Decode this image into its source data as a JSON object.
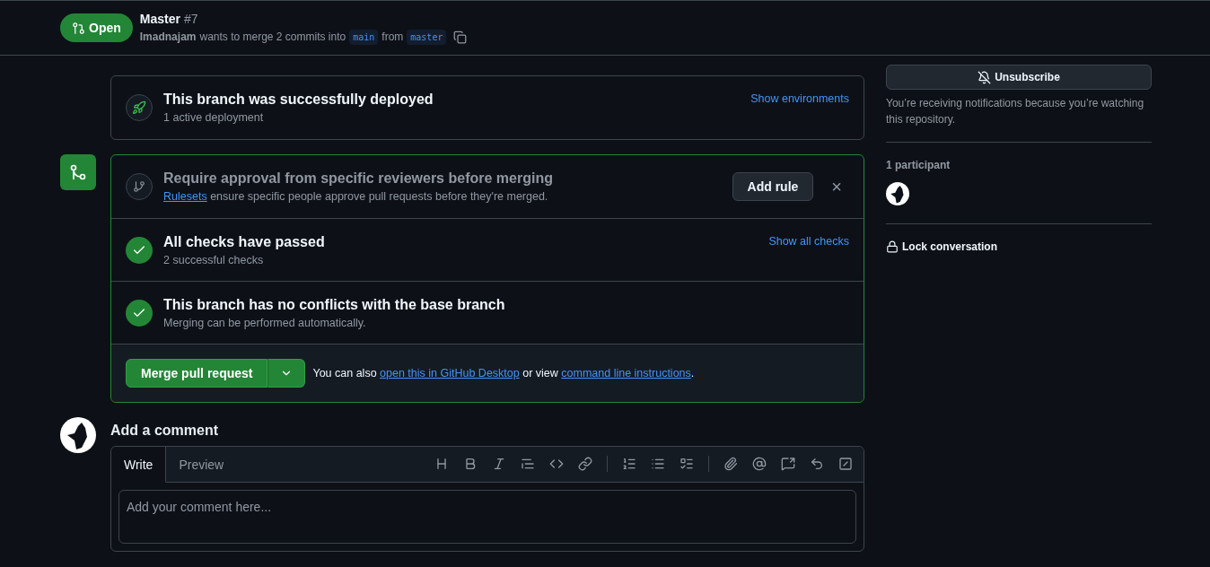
{
  "header": {
    "state": "Open",
    "title": "Master",
    "number": "#7",
    "author": "Imadnajam",
    "summary": "wants to merge 2 commits into",
    "base_branch": "main",
    "joiner": "from",
    "head_branch": "master"
  },
  "deployment": {
    "title": "This branch was successfully deployed",
    "subtitle": "1 active deployment",
    "action": "Show environments"
  },
  "merge_box": {
    "sections": [
      {
        "kind": "rule",
        "title": "Require approval from specific reviewers before merging",
        "link": "Rulesets",
        "text": "ensure specific people approve pull requests before they're merged.",
        "button": "Add rule",
        "close": "×"
      },
      {
        "kind": "check",
        "title": "All checks have passed",
        "subtitle": "2 successful checks",
        "action": "Show all checks"
      },
      {
        "kind": "check",
        "title": "This branch has no conflicts with the base branch",
        "subtitle": "Merging can be performed automatically."
      }
    ],
    "merge_button": "Merge pull request",
    "also_text": "You can also",
    "desktop_link": "open this in GitHub Desktop",
    "or_view": "or view",
    "cli_link": "command line instructions",
    "period": "."
  },
  "comment": {
    "heading": "Add a comment",
    "tabs": [
      {
        "label": "Write",
        "selected": true
      },
      {
        "label": "Preview",
        "selected": false
      }
    ],
    "placeholder": "Add your comment here..."
  },
  "sidebar": {
    "unsubscribe": "Unsubscribe",
    "notice": "You’re receiving notifications because you’re watching this repository.",
    "participants": "1 participant",
    "lock": "Lock conversation"
  }
}
